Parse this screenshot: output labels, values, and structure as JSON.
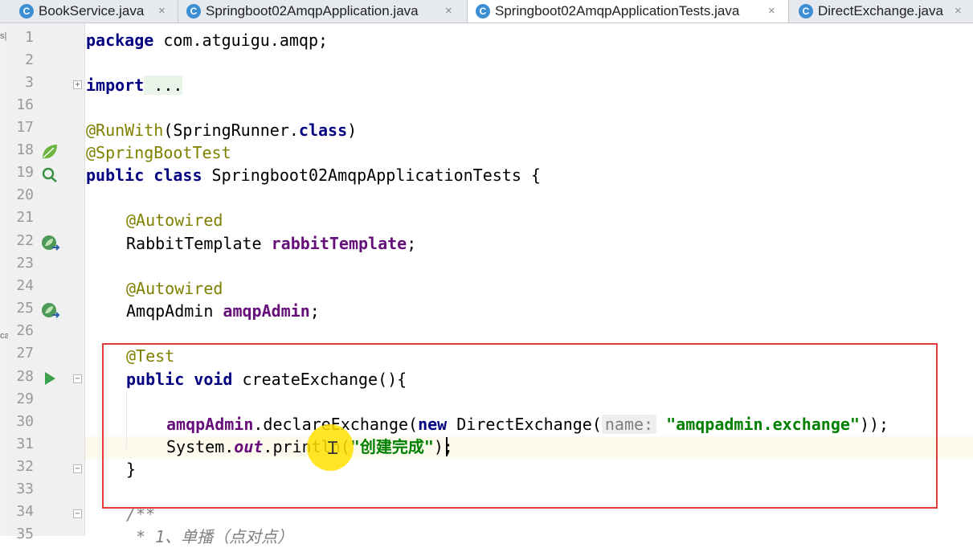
{
  "tabs": [
    {
      "label": "BookService.java",
      "icon": "class-icon",
      "active": false
    },
    {
      "label": "Springboot02AmqpApplication.java",
      "icon": "spring-class-icon",
      "active": false
    },
    {
      "label": "Springboot02AmqpApplicationTests.java",
      "icon": "spring-class-icon",
      "active": true
    },
    {
      "label": "DirectExchange.java",
      "icon": "class-icon",
      "active": false
    }
  ],
  "close_glyph": "×",
  "tab_icon_letter": "C",
  "left_strip_fragments": [
    "s|",
    "ca"
  ],
  "line_numbers": [
    "1",
    "2",
    "3",
    "16",
    "17",
    "18",
    "19",
    "20",
    "21",
    "22",
    "23",
    "24",
    "25",
    "26",
    "27",
    "28",
    "29",
    "30",
    "31",
    "32",
    "33",
    "34",
    "35"
  ],
  "code": {
    "l1_kw": "package",
    "l1_rest": " com.atguigu.amqp;",
    "l3_kw": "import",
    "l3_fold": " ...",
    "l17_ann": "@RunWith",
    "l17_mid": "(SpringRunner.",
    "l17_kw": "class",
    "l17_end": ")",
    "l18_ann": "@SpringBootTest",
    "l19_kw": "public class",
    "l19_rest": " Springboot02AmqpApplicationTests {",
    "l21_ann": "@Autowired",
    "l22_type": "RabbitTemplate ",
    "l22_field": "rabbitTemplate",
    "l22_end": ";",
    "l24_ann": "@Autowired",
    "l25_type": "AmqpAdmin ",
    "l25_field": "amqpAdmin",
    "l25_end": ";",
    "l27_ann": "@Test",
    "l28_kw": "public void",
    "l28_rest": " createExchange(){",
    "l30_field": "amqpAdmin",
    "l30_mid": ".declareExchange(",
    "l30_kw": "new",
    "l30_mid2": " DirectExchange(",
    "l30_hint": "name:",
    "l30_str": "\"amqpadmin.exchange\"",
    "l30_end": "));",
    "l31_a": "System.",
    "l31_out": "out",
    "l31_b": ".println(",
    "l31_str": "\"创建完成\"",
    "l31_end": ");",
    "l32": "}",
    "l34": "/**",
    "l35": " * 1、单播（点对点）"
  }
}
